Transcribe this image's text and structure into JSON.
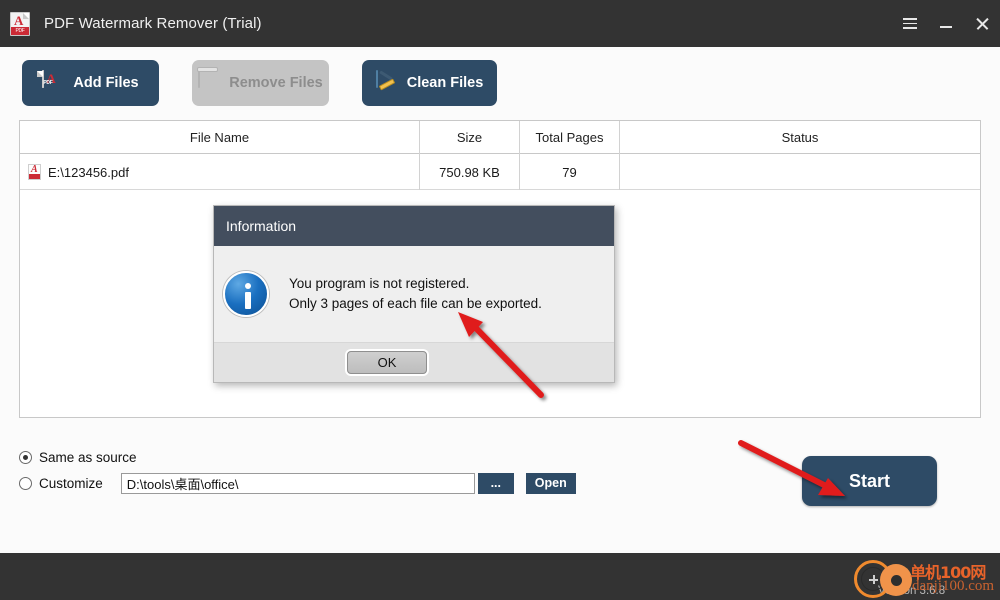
{
  "window": {
    "title": "PDF Watermark Remover (Trial)",
    "app_icon": "pdf-file-icon",
    "controls": {
      "menu": "menu-icon",
      "minimize": "minimize-icon",
      "close": "close-icon"
    }
  },
  "toolbar": {
    "add_files": "Add Files",
    "remove_files": "Remove Files",
    "clean_files": "Clean Files"
  },
  "table": {
    "columns": [
      "File Name",
      "Size",
      "Total Pages",
      "Status"
    ],
    "rows": [
      {
        "file_name": "E:\\123456.pdf",
        "size": "750.98 KB",
        "total_pages": "79",
        "status": ""
      }
    ]
  },
  "output": {
    "same_as_source": "Same as source",
    "customize": "Customize",
    "path_value": "D:\\tools\\桌面\\office\\",
    "browse_label": "...",
    "open_label": "Open",
    "selected": "same_as_source"
  },
  "start_button": "Start",
  "statusbar": {
    "version": "Version 3.6.8",
    "watermark_cn": "单机100网",
    "watermark_url": "danji100.com"
  },
  "dialog": {
    "title": "Information",
    "icon": "info-icon",
    "line1": "You program is not registered.",
    "line2": "Only 3 pages of each file can be exported.",
    "ok_label": "OK"
  },
  "colors": {
    "titlebar": "#333333",
    "accent": "#2e4b66",
    "dialog_header": "#434e5e",
    "disabled": "#c4c4c4",
    "annotation_arrow": "#e01b1b",
    "watermark": "#e8632a"
  }
}
